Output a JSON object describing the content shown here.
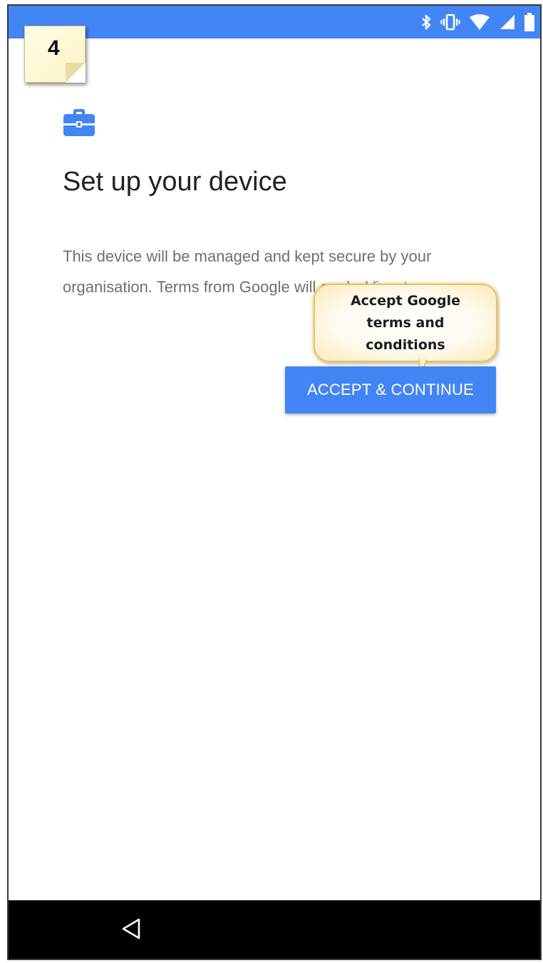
{
  "step": {
    "number": "4"
  },
  "header": {
    "title": "Set up your device"
  },
  "description": {
    "text": "This device will be managed and kept secure by your organisation. Terms from Google will apply.",
    "link_label": "View terms"
  },
  "callout": {
    "text": "Accept Google terms and conditions"
  },
  "actions": {
    "accept_label": "ACCEPT & CONTINUE"
  },
  "status_bar": {
    "icons": [
      "bluetooth-icon",
      "vibrate-icon",
      "wifi-icon",
      "signal-icon",
      "battery-icon"
    ]
  },
  "navigation": {
    "back_icon": "back-triangle-icon"
  },
  "colors": {
    "accent": "#4285f4",
    "link": "#3b7ee8",
    "title": "#222222",
    "body_text": "#6f6f6f",
    "nav_bar": "#000000",
    "note": "#fbf3c4"
  }
}
